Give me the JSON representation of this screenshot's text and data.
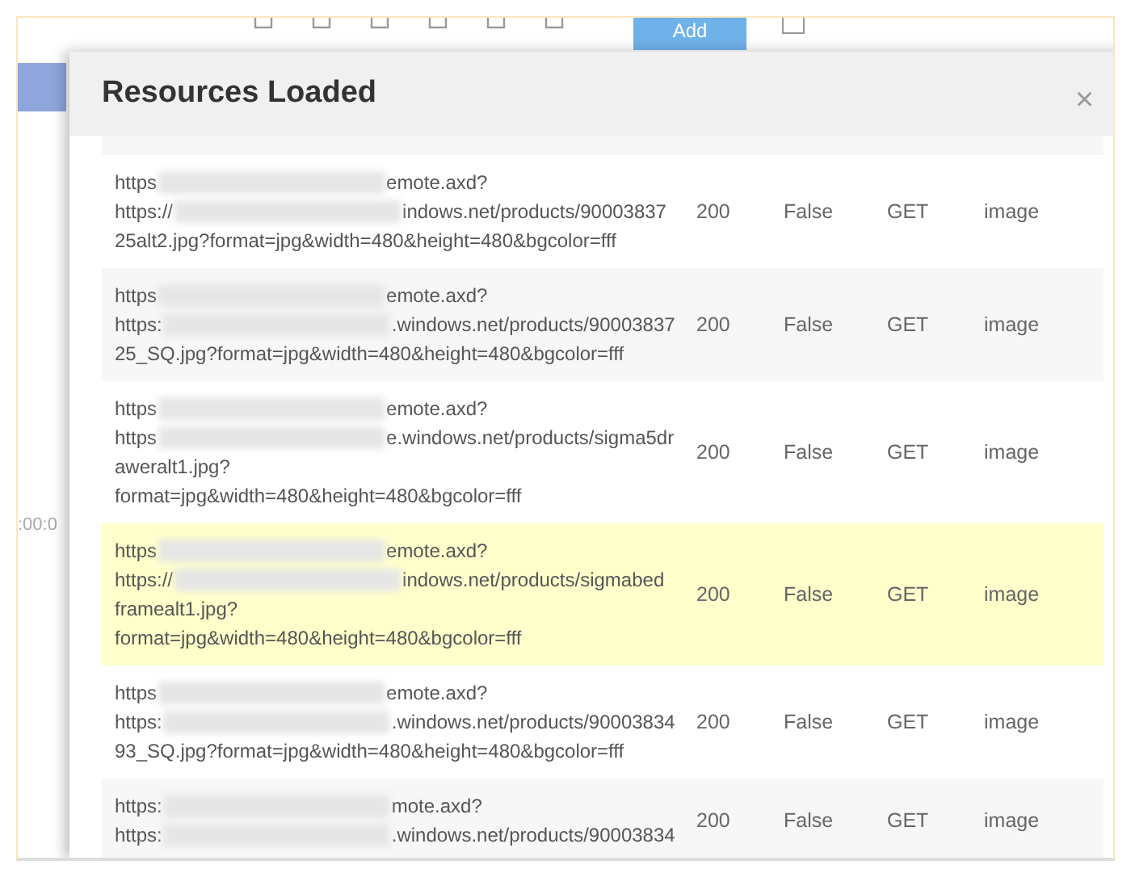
{
  "toolbar": {
    "add_button": "Add"
  },
  "background_page": {
    "time_fragment": ":00:0"
  },
  "dialog": {
    "title": "Resources Loaded",
    "close": "×",
    "rows": [
      {
        "selected": false,
        "url_lines": [
          {
            "kind": "redacted",
            "start": "https",
            "end": "emote.axd?"
          },
          {
            "kind": "redacted",
            "start": "https://",
            "end": "indows.net/products/90003837"
          },
          {
            "kind": "plain",
            "text": "25alt2.jpg?format=jpg&width=480&height=480&bgcolor=fff"
          }
        ],
        "status": "200",
        "cached": "False",
        "method": "GET",
        "type": "image"
      },
      {
        "selected": false,
        "url_lines": [
          {
            "kind": "redacted",
            "start": "https",
            "end": "emote.axd?"
          },
          {
            "kind": "redacted",
            "start": "https:",
            "end": ".windows.net/products/90003837"
          },
          {
            "kind": "plain",
            "text": "25_SQ.jpg?format=jpg&width=480&height=480&bgcolor=fff"
          }
        ],
        "status": "200",
        "cached": "False",
        "method": "GET",
        "type": "image"
      },
      {
        "selected": false,
        "url_lines": [
          {
            "kind": "redacted",
            "start": "https",
            "end": "emote.axd?"
          },
          {
            "kind": "redacted",
            "start": "https",
            "end": "e.windows.net/products/sigma5dr"
          },
          {
            "kind": "plain",
            "text": "aweralt1.jpg?"
          },
          {
            "kind": "plain",
            "text": "format=jpg&width=480&height=480&bgcolor=fff"
          }
        ],
        "status": "200",
        "cached": "False",
        "method": "GET",
        "type": "image"
      },
      {
        "selected": true,
        "url_lines": [
          {
            "kind": "redacted",
            "start": "https",
            "end": "emote.axd?"
          },
          {
            "kind": "redacted",
            "start": "https://",
            "end": "indows.net/products/sigmabed"
          },
          {
            "kind": "plain",
            "text": "framealt1.jpg?"
          },
          {
            "kind": "plain",
            "text": "format=jpg&width=480&height=480&bgcolor=fff"
          }
        ],
        "status": "200",
        "cached": "False",
        "method": "GET",
        "type": "image"
      },
      {
        "selected": false,
        "url_lines": [
          {
            "kind": "redacted",
            "start": "https",
            "end": "emote.axd?"
          },
          {
            "kind": "redacted",
            "start": "https:",
            "end": ".windows.net/products/90003834"
          },
          {
            "kind": "plain",
            "text": "93_SQ.jpg?format=jpg&width=480&height=480&bgcolor=fff"
          }
        ],
        "status": "200",
        "cached": "False",
        "method": "GET",
        "type": "image"
      },
      {
        "selected": false,
        "url_lines": [
          {
            "kind": "redacted",
            "start": "https:",
            "end": "mote.axd?"
          },
          {
            "kind": "redacted",
            "start": "https:",
            "end": ".windows.net/products/90003834"
          }
        ],
        "status": "200",
        "cached": "False",
        "method": "GET",
        "type": "image"
      }
    ]
  }
}
